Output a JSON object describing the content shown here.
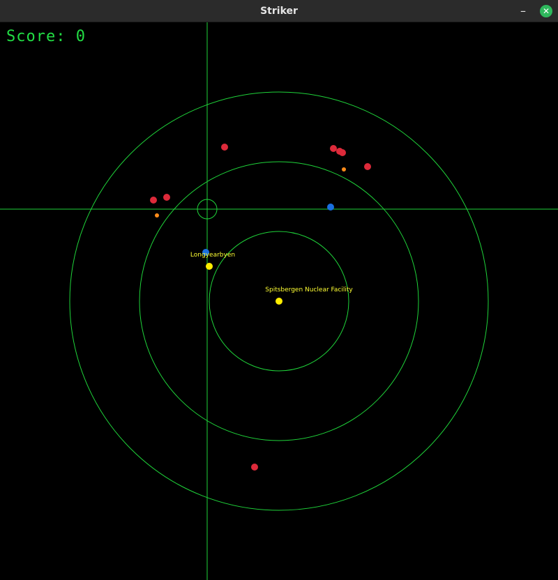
{
  "window": {
    "title": "Striker"
  },
  "controls": {
    "minimize_glyph": "–",
    "close_glyph": "✕"
  },
  "hud": {
    "score_label": "Score: 0"
  },
  "colors": {
    "radar": "#1fd43a",
    "enemy": "#dd2a3a",
    "missile": "#ff8c1a",
    "friendly": "#1a6fe0",
    "target": "#ffee00",
    "label": "#ffff44"
  },
  "targets": [
    {
      "name": "Longyearbyen"
    },
    {
      "name": "Spitsbergen Nuclear Facility"
    }
  ]
}
